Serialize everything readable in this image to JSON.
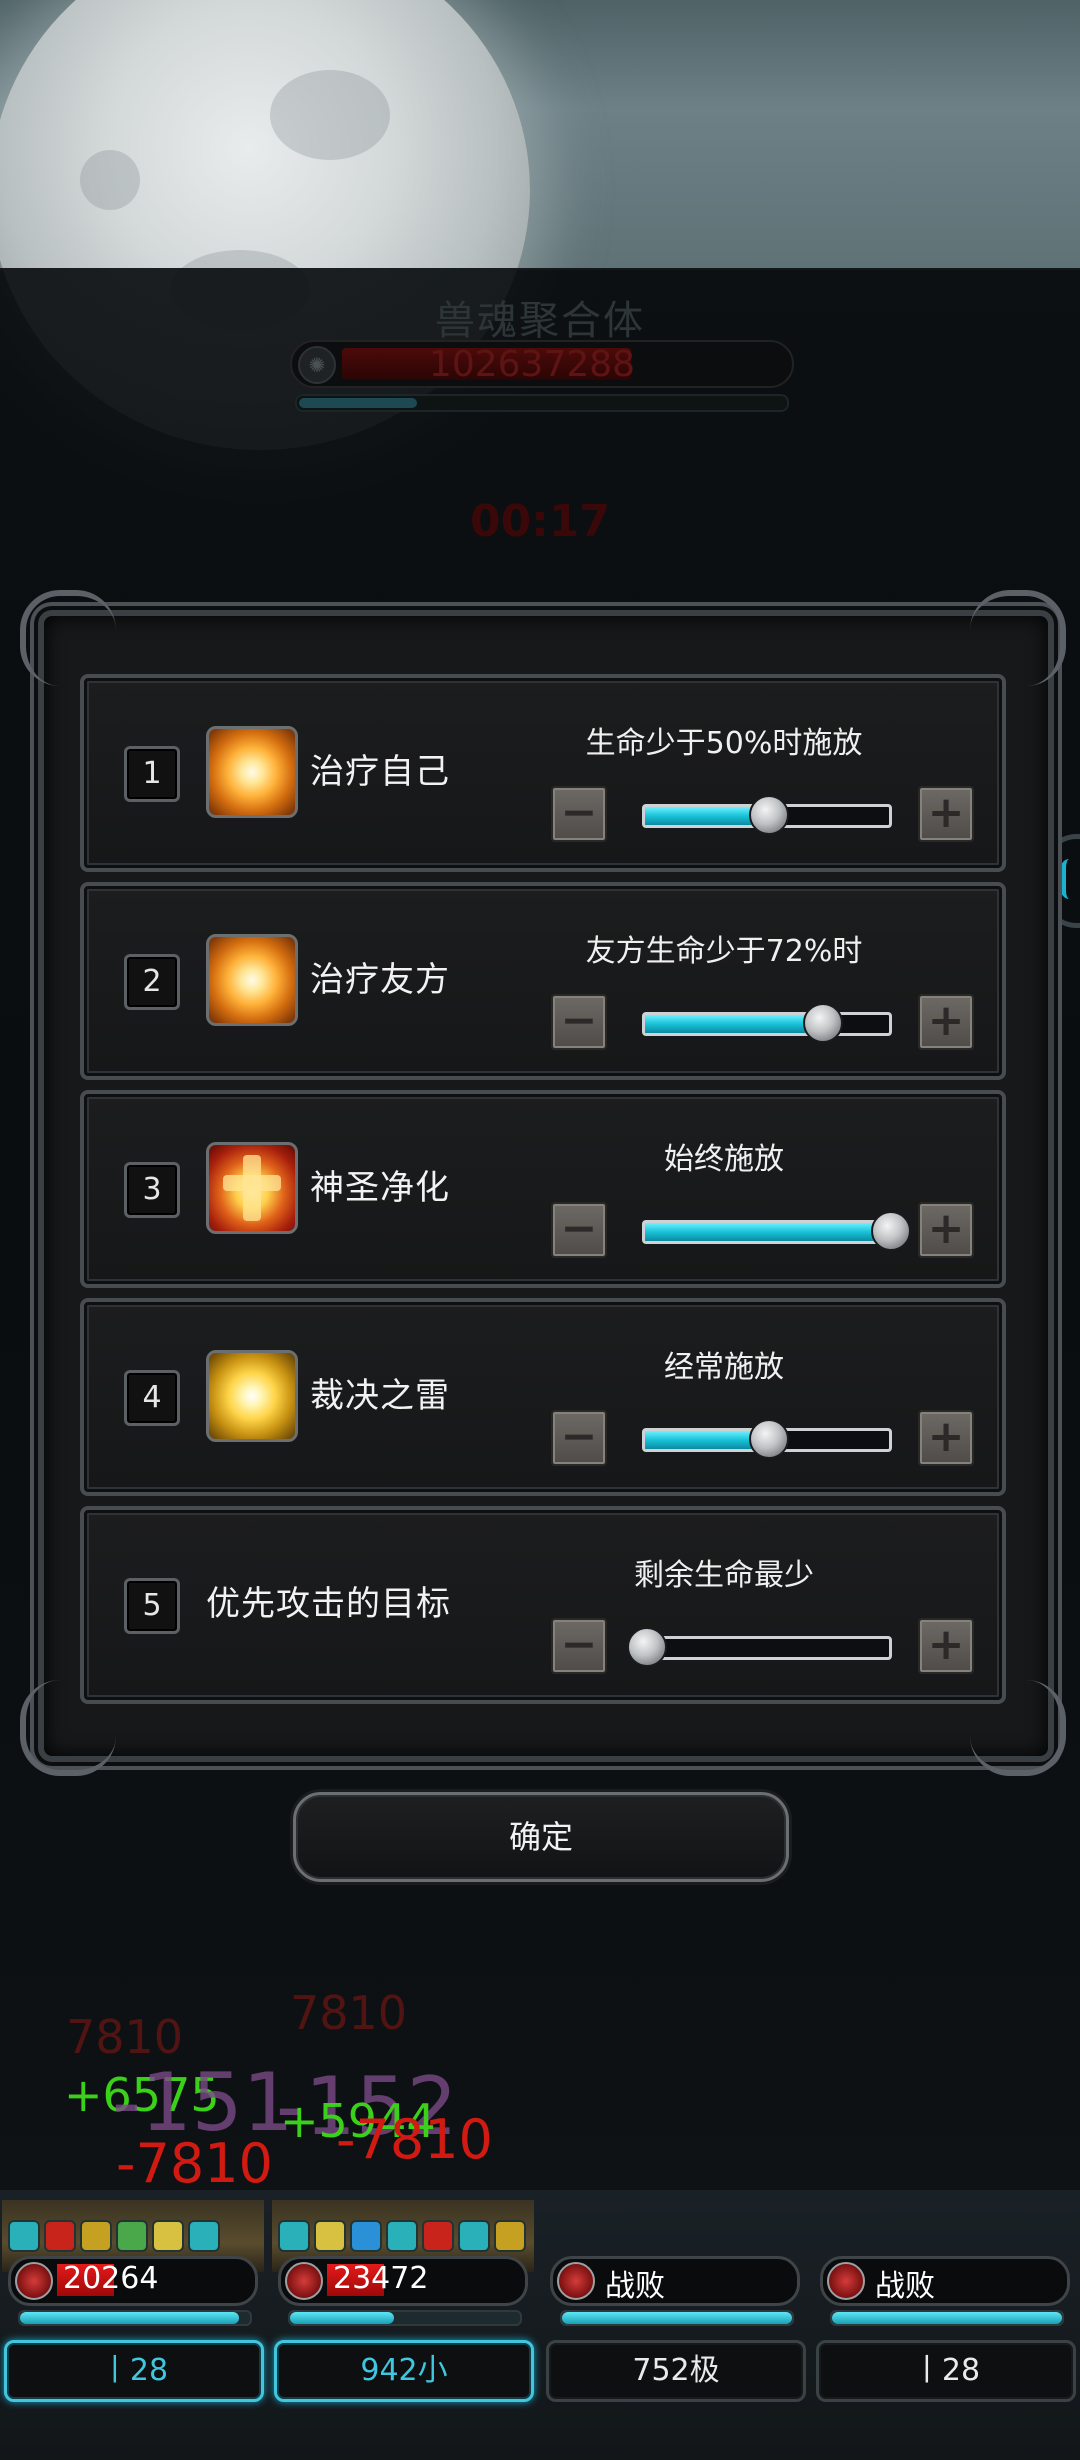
{
  "boss": {
    "name": "兽魂聚合体",
    "hp": "102637288",
    "hp_fraction": 0.76,
    "sub_fraction": 0.24
  },
  "timer": "00:17",
  "skills": [
    {
      "number": "1",
      "name": "治疗自己",
      "condition": "生命少于50%时施放",
      "icon": "heal-icon",
      "slider_value": 50
    },
    {
      "number": "2",
      "name": "治疗友方",
      "condition": "友方生命少于72%时",
      "icon": "heal-icon",
      "slider_value": 72
    },
    {
      "number": "3",
      "name": "神圣净化",
      "condition": "始终施放",
      "icon": "purify-icon",
      "slider_value": 100
    },
    {
      "number": "4",
      "name": "裁决之雷",
      "condition": "经常施放",
      "icon": "thunder-icon",
      "slider_value": 50
    },
    {
      "number": "5",
      "name": "优先攻击的目标",
      "condition": "剩余生命最少",
      "icon": "",
      "slider_value": 0
    }
  ],
  "controls": {
    "minus_glyph": "−",
    "plus_glyph": "+"
  },
  "confirm_label": "确定",
  "combat_text": [
    {
      "text": "7810",
      "color": "red"
    },
    {
      "text": "7810",
      "color": "red"
    },
    {
      "text": "+6575",
      "color": "green"
    },
    {
      "text": "-151",
      "color": "purple"
    },
    {
      "text": "-152",
      "color": "purple"
    },
    {
      "text": "+5944",
      "color": "green"
    },
    {
      "text": "-7810",
      "color": "red"
    },
    {
      "text": "-7810",
      "color": "red"
    }
  ],
  "party": [
    {
      "hp": "20264",
      "hp_fraction": 0.3,
      "mana_fraction": 0.95,
      "name": "丨28",
      "state": "active"
    },
    {
      "hp": "23472",
      "hp_fraction": 0.3,
      "mana_fraction": 0.45,
      "name": "942小",
      "state": "active"
    },
    {
      "hp": "战败",
      "hp_fraction": 0,
      "mana_fraction": 1.0,
      "name": "752极",
      "state": "down"
    },
    {
      "hp": "战败",
      "hp_fraction": 0,
      "mana_fraction": 1.0,
      "name": "丨28",
      "state": "down"
    }
  ],
  "colors": {
    "accent": "#1ab3cf",
    "hp_red": "#d01a12",
    "heal_green": "#3bd11a"
  }
}
